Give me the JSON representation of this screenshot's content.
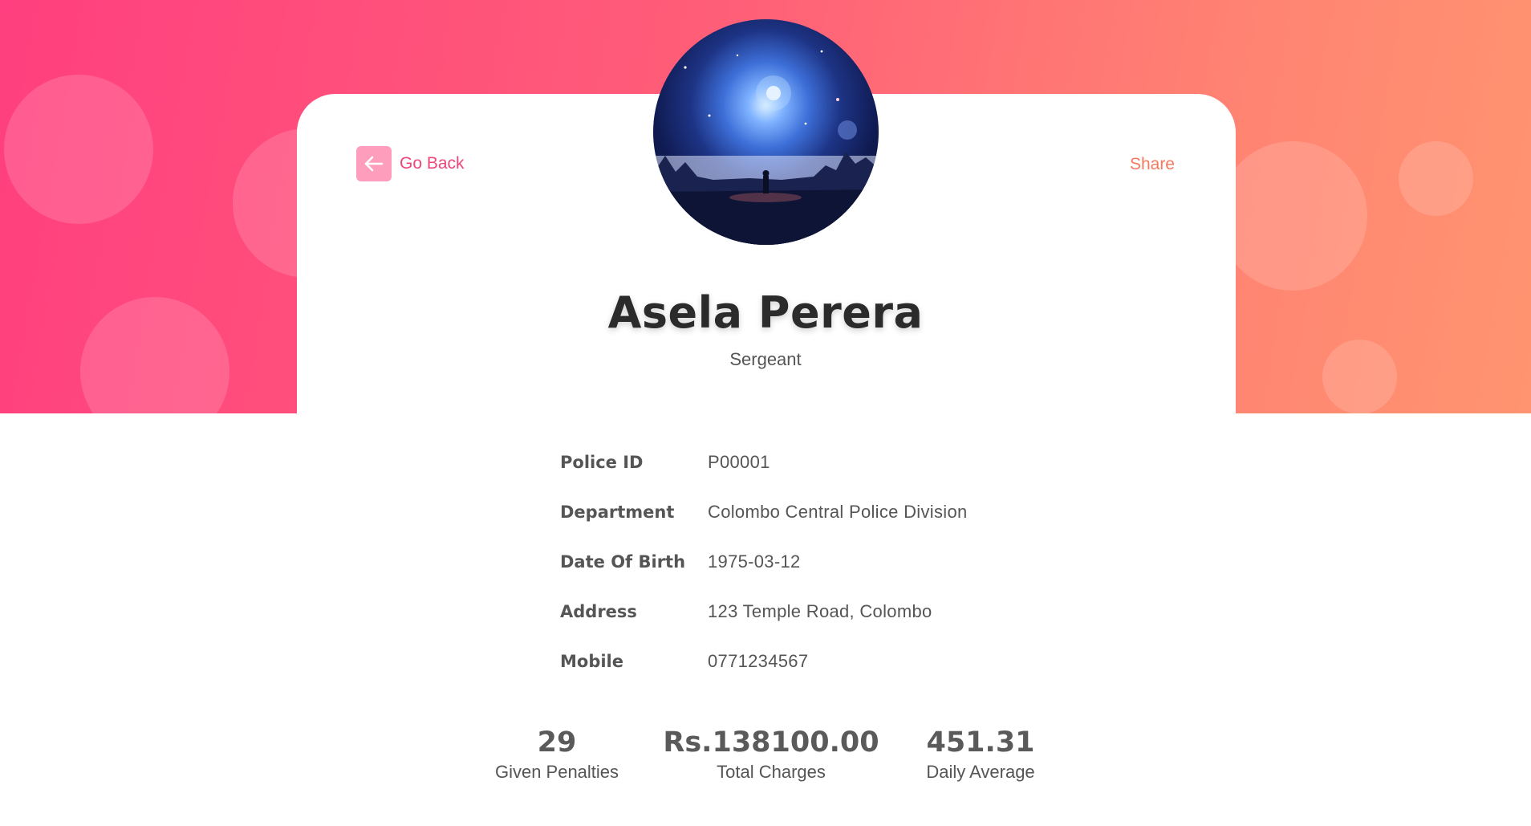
{
  "header": {
    "back_label": "Go Back",
    "share_label": "Share"
  },
  "profile": {
    "name": "Asela Perera",
    "rank": "Sergeant",
    "avatar_icon": "profile-avatar-space-image"
  },
  "details": {
    "police_id": {
      "label": "Police ID",
      "value": "P00001"
    },
    "department": {
      "label": "Department",
      "value": "Colombo Central Police Division"
    },
    "dob": {
      "label": "Date Of Birth",
      "value": "1975-03-12"
    },
    "address": {
      "label": "Address",
      "value": "123 Temple Road, Colombo"
    },
    "mobile": {
      "label": "Mobile",
      "value": "0771234567"
    }
  },
  "stats": {
    "penalties": {
      "value": "29",
      "label": "Given Penalties"
    },
    "charges": {
      "value": "Rs.138100.00",
      "label": "Total Charges"
    },
    "average": {
      "value": "451.31",
      "label": "Daily Average"
    }
  },
  "colors": {
    "gradient_start": "#ff3f7f",
    "gradient_end": "#ff9470",
    "back_accent": "#f0457a",
    "share_accent": "#f5795f"
  }
}
